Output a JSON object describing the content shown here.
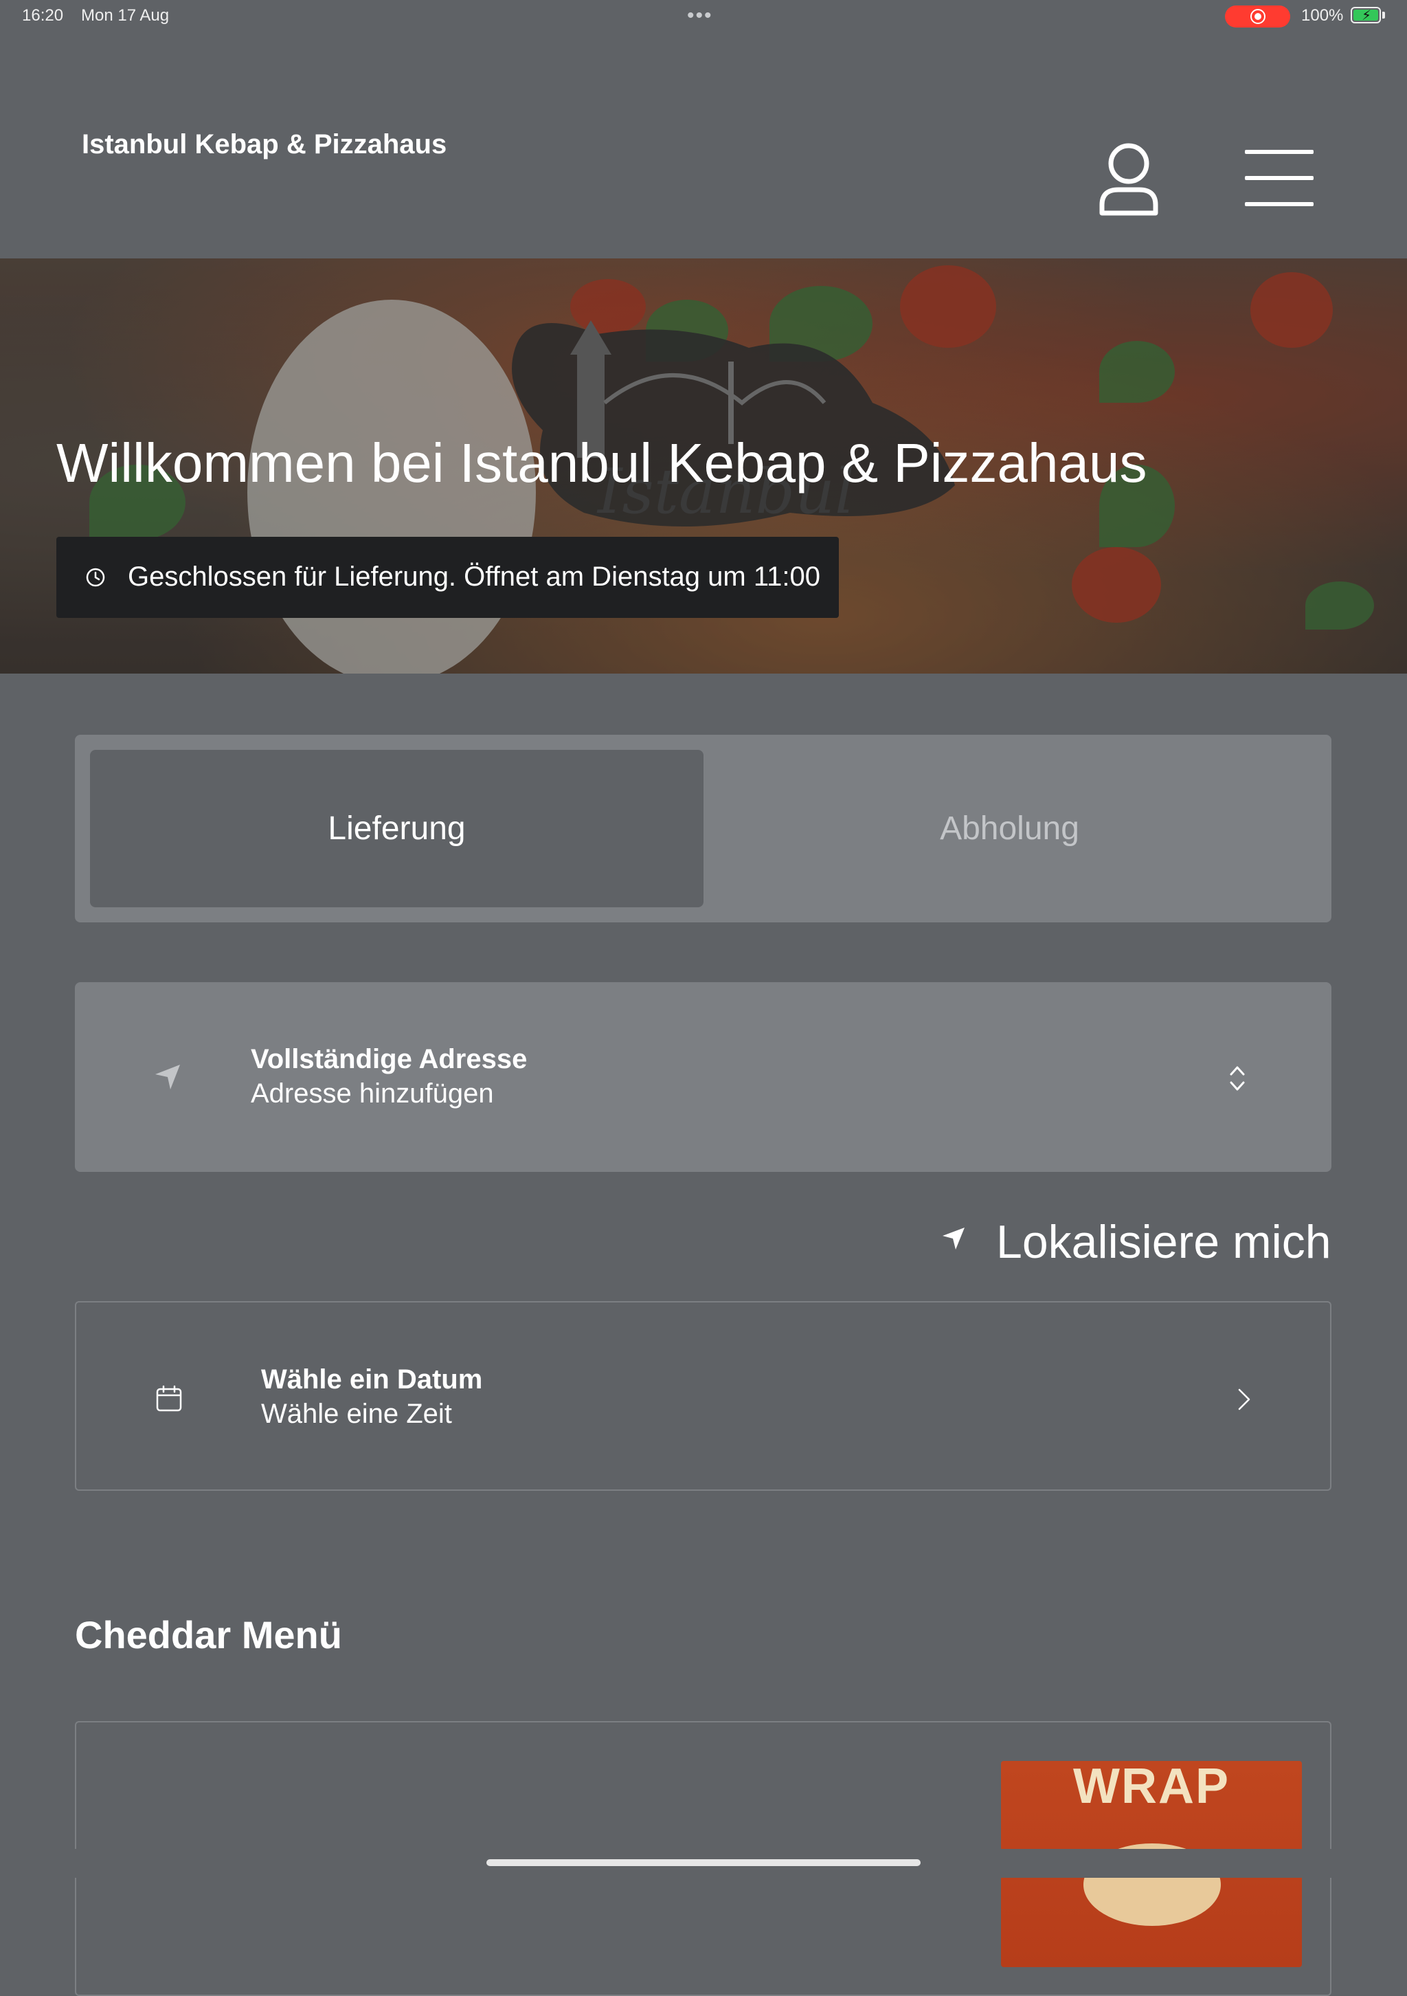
{
  "status_bar": {
    "time": "16:20",
    "date": "Mon 17 Aug",
    "multitask_dots": "•••",
    "battery_percent": "100%",
    "recording_color": "#ff3b30",
    "battery_color": "#34c759"
  },
  "header": {
    "brand": "Istanbul Kebap & Pizzahaus",
    "account_icon": "person-icon",
    "menu_icon": "hamburger-menu-icon"
  },
  "hero": {
    "title": "Willkommen bei Istanbul Kebap & Pizzahaus",
    "closed_notice": "Geschlossen für Lieferung. Öffnet am Dienstag um 11:00",
    "clock_icon": "clock-icon"
  },
  "order_mode": {
    "options": [
      "Lieferung",
      "Abholung"
    ],
    "selected": "Lieferung"
  },
  "address": {
    "label": "Vollständige Adresse",
    "placeholder": "Adresse hinzufügen",
    "icon": "navigation-arrow-icon",
    "expand_icon": "chevron-up-down-icon"
  },
  "locate_me": {
    "label": "Lokalisiere mich",
    "icon": "location-arrow-icon"
  },
  "schedule": {
    "date_label": "Wähle ein Datum",
    "time_label": "Wähle eine Zeit",
    "icon": "calendar-icon",
    "chevron_icon": "chevron-right-icon"
  },
  "menu_section": {
    "title": "Cheddar Menü",
    "product_image_text": "WRAP"
  },
  "colors": {
    "background": "#5f6266",
    "panel": "#7c7f83",
    "banner": "#1f2022"
  }
}
